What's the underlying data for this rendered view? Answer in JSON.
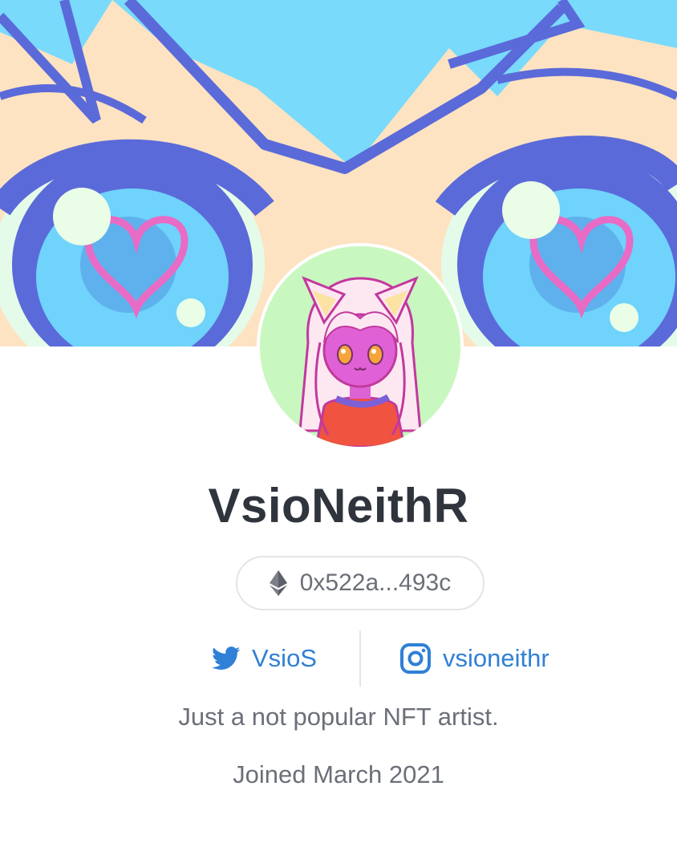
{
  "profile": {
    "username": "VsioNeithR",
    "wallet_address": "0x522a...493c",
    "bio": "Just a not popular NFT artist.",
    "joined": "Joined March 2021"
  },
  "socials": {
    "twitter": {
      "handle": "VsioS",
      "icon": "twitter-bird-icon"
    },
    "instagram": {
      "handle": "vsioneithr",
      "icon": "instagram-icon"
    }
  },
  "icons": {
    "wallet_chain": "ethereum-icon"
  },
  "colors": {
    "link": "#2f80d6",
    "username": "#2f343d",
    "muted_text": "#6b6f78",
    "avatar_bg": "#c9f7c0",
    "banner_sky": "#79dafc",
    "banner_skin": "#fde3c2",
    "banner_eye": "#5b6ad9"
  }
}
